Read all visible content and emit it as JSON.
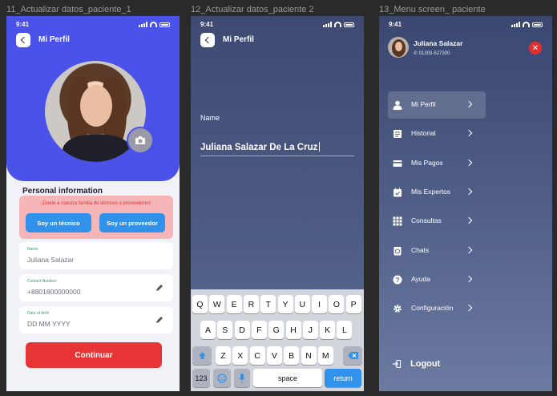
{
  "frames": {
    "f1_title": "11_Actualizar datos_paciente_1",
    "f2_title": "12_Actualizar datos_paciente 2",
    "f3_title": "13_Menu screen_ paciente"
  },
  "status": {
    "time": "9:41"
  },
  "screen1": {
    "header_title": "Mi Perfil",
    "section_title": "Personal information",
    "promo_text": "¡Únete a nuestra familia de técnicos y proveedores!",
    "btn_tecnico": "Soy un técnico",
    "btn_proveedor": "Soy un proveedor",
    "fields": [
      {
        "label": "Name",
        "value": "Juliana Salazar"
      },
      {
        "label": "Contact Number",
        "value": "+8801800000000"
      },
      {
        "label": "Date of birth",
        "value": "DD MM YYYY"
      }
    ],
    "continue_label": "Continuar"
  },
  "screen2": {
    "header_title": "Mi Perfil",
    "name_label": "Name",
    "name_value": "Juliana Salazar De La Cruz",
    "keyboard": {
      "row1": [
        "Q",
        "W",
        "E",
        "R",
        "T",
        "Y",
        "U",
        "I",
        "O",
        "P"
      ],
      "row2": [
        "A",
        "S",
        "D",
        "F",
        "G",
        "H",
        "J",
        "K",
        "L"
      ],
      "row3": [
        "Z",
        "X",
        "C",
        "V",
        "B",
        "N",
        "M"
      ],
      "numbers": "123",
      "space": "space",
      "return": "return"
    }
  },
  "screen3": {
    "user_name": "Juliana Salazar",
    "user_phone": "01303-527300",
    "menu": [
      {
        "label": "Mi Perfil",
        "icon": "user-icon"
      },
      {
        "label": "Historial",
        "icon": "history-icon"
      },
      {
        "label": "Mis Pagos",
        "icon": "card-icon"
      },
      {
        "label": "Mis Expertos",
        "icon": "calendar-icon"
      },
      {
        "label": "Consultas",
        "icon": "grid-icon"
      },
      {
        "label": "Chats",
        "icon": "chat-icon"
      },
      {
        "label": "Ayuda",
        "icon": "help-icon"
      },
      {
        "label": "Configuración",
        "icon": "gear-icon"
      }
    ],
    "logout_label": "Logout"
  },
  "colors": {
    "primary": "#4a52ea",
    "accent_blue": "#3192ec",
    "danger": "#e73535"
  }
}
